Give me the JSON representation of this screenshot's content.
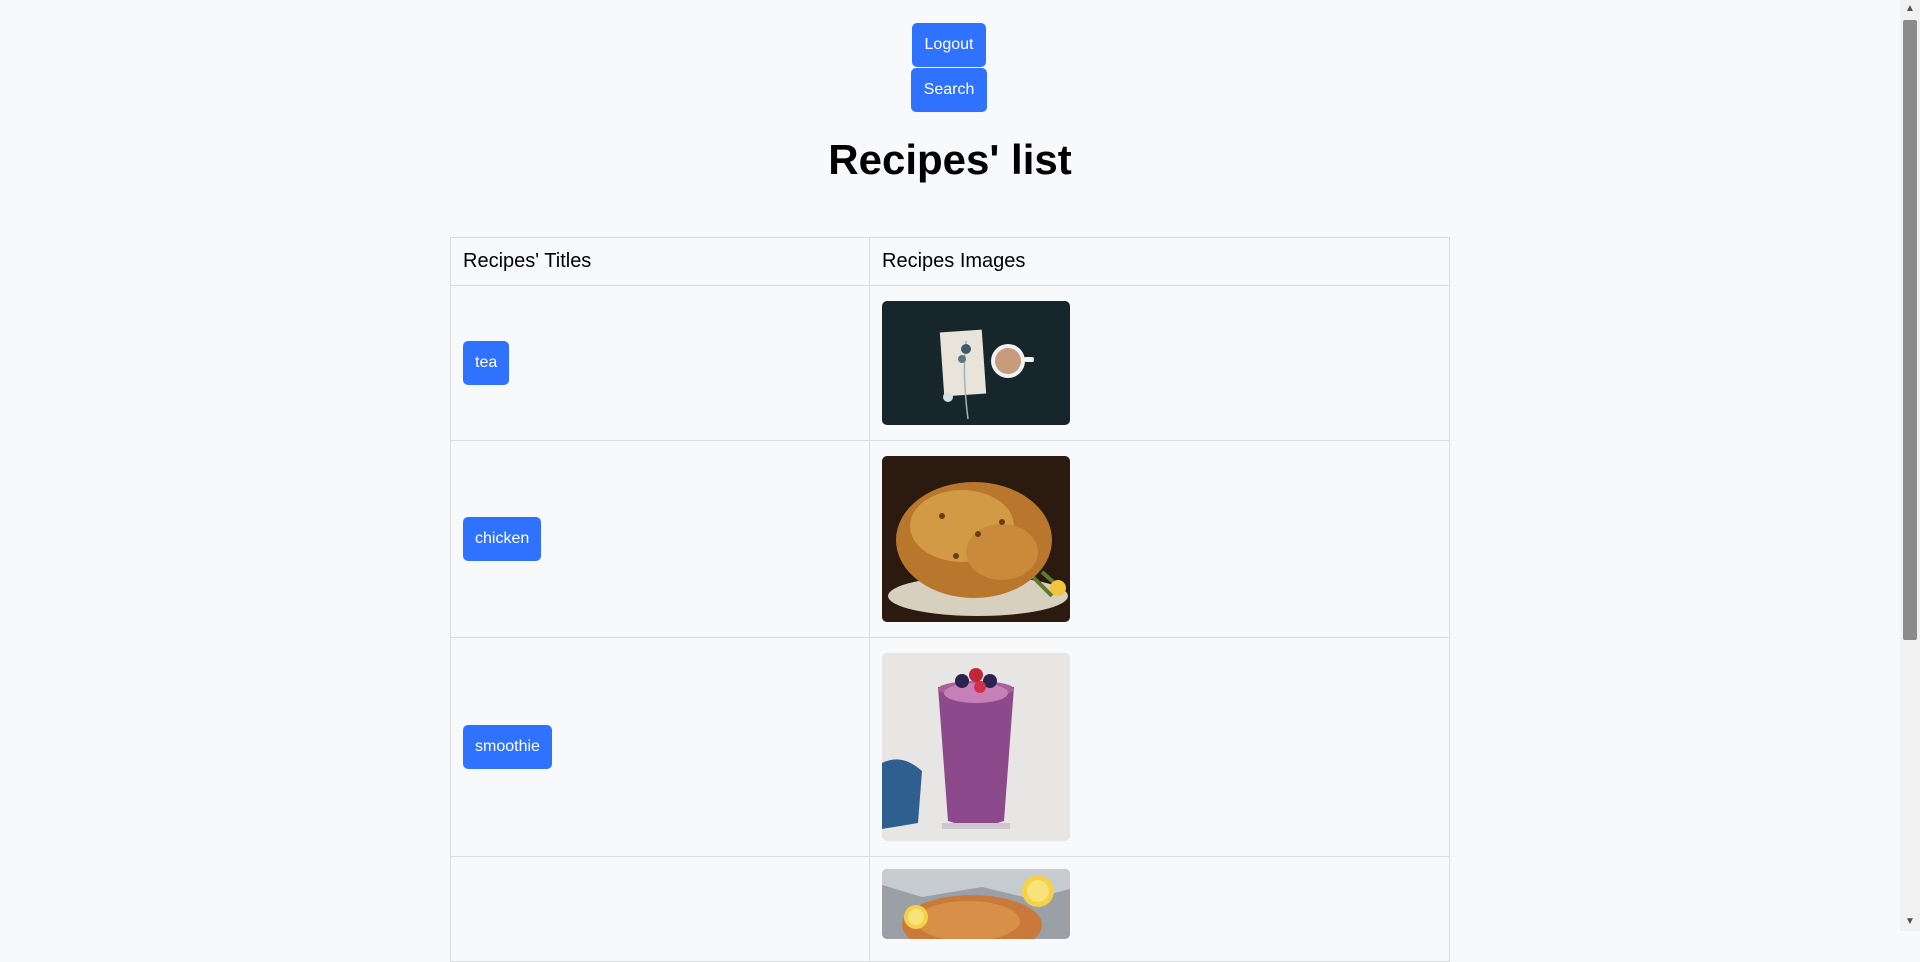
{
  "header": {
    "logout_label": "Logout",
    "search_label": "Search"
  },
  "page_title": "Recipes' list",
  "table": {
    "columns": [
      "Recipes' Titles",
      "Recipes Images"
    ],
    "rows": [
      {
        "title": "tea"
      },
      {
        "title": "chicken"
      },
      {
        "title": "smoothie"
      },
      {
        "title": ""
      }
    ]
  },
  "colors": {
    "accent": "#2f72ff",
    "background": "#f8f9fb"
  }
}
